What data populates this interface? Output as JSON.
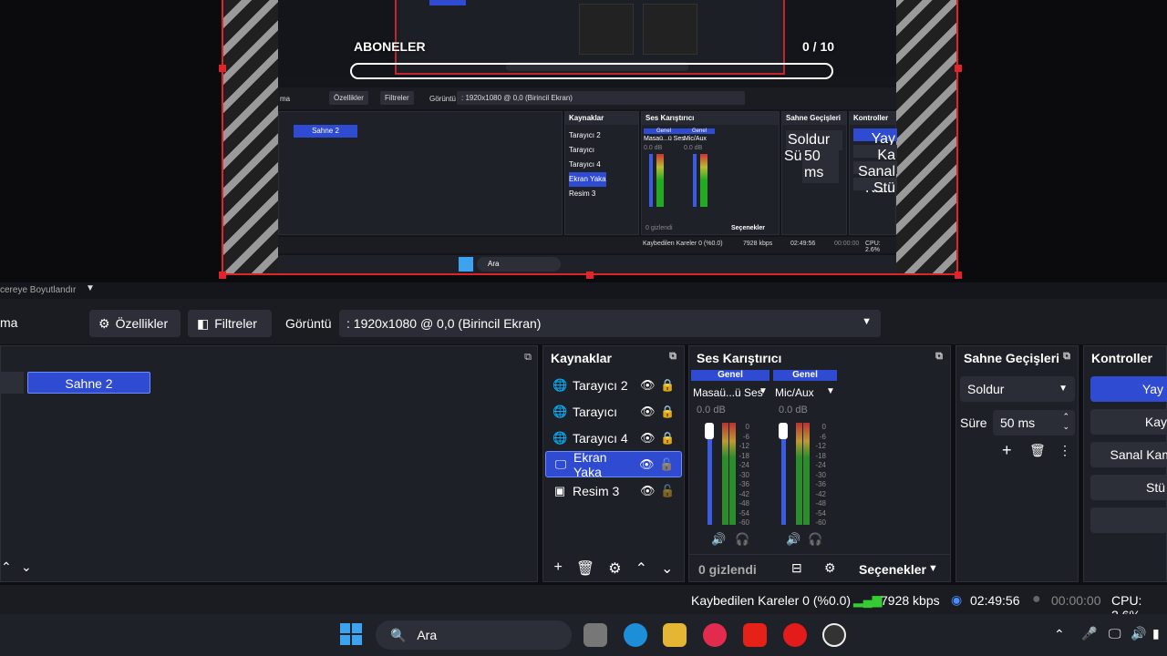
{
  "overlay": {
    "subscribers_label": "ABONELER",
    "subscribers_count": "0 / 10"
  },
  "mini": {
    "toolbar_left": "ma",
    "props": "Özellikler",
    "filters": "Filtreler",
    "display_label": "Görüntü",
    "display_value": ": 1920x1080 @ 0,0 (Birincil Ekran)",
    "scene": "Sahne 2",
    "sources_title": "Kaynaklar",
    "sources": [
      "Tarayıcı 2",
      "Tarayıcı",
      "Tarayıcı 4",
      "Ekran Yaka",
      "Resim 3"
    ],
    "mixer_title": "Ses Karıştırıcı",
    "ch1_label": "Genel",
    "ch2_label": "Genel",
    "ch1": "Masaü...ü Ses",
    "ch2": "Mic/Aux",
    "db": "0.0 dB",
    "hidden": "0 gizlendi",
    "options": "Seçenekler",
    "trans_title": "Sahne Geçişleri",
    "trans": "Soldur",
    "dur_label": "Süre",
    "dur": "50 ms",
    "controls_title": "Kontroller",
    "ctrl": [
      "Yay",
      "Ka",
      "Sanal Kam",
      "Stü"
    ],
    "status": "Kaybedilen Kareler 0 (%0.0)",
    "kbps": "7928 kbps",
    "time": "02:49:56",
    "rec": "00:00:00",
    "cpu": "CPU: 2.6%",
    "search": "Ara"
  },
  "strip": {
    "text": "cereye Boyutlandır"
  },
  "toolbar": {
    "left_text": "ma",
    "properties": "Özellikler",
    "filters": "Filtreler",
    "display_label": "Görüntü",
    "display_value": ": 1920x1080 @ 0,0 (Birincil Ekran)"
  },
  "scenes": {
    "scene2": "Sahne 2"
  },
  "sources": {
    "title": "Kaynaklar",
    "items": [
      "Tarayıcı 2",
      "Tarayıcı",
      "Tarayıcı 4",
      "Ekran Yaka",
      "Resim 3"
    ]
  },
  "mixer": {
    "title": "Ses Karıştırıcı",
    "ch1_header": "Genel",
    "ch2_header": "Genel",
    "ch1_name": "Masaü...ü Ses",
    "ch2_name": "Mic/Aux",
    "ch1_db": "0.0 dB",
    "ch2_db": "0.0 dB",
    "scale": [
      "0",
      "-6",
      "-12",
      "-18",
      "-24",
      "-30",
      "-36",
      "-42",
      "-48",
      "-54",
      "-60"
    ],
    "hidden": "0 gizlendi",
    "options": "Seçenekler"
  },
  "transitions": {
    "title": "Sahne Geçişleri",
    "value": "Soldur",
    "duration_label": "Süre",
    "duration": "50 ms"
  },
  "controls": {
    "title": "Kontroller",
    "buttons": [
      "Yay",
      "Kay",
      "Sanal Kam",
      "Stü"
    ]
  },
  "status": {
    "dropped": "Kaybedilen Kareler 0 (%0.0)",
    "kbps": "7928 kbps",
    "stream_time": "02:49:56",
    "rec_time": "00:00:00",
    "cpu": "CPU: 2.6%"
  },
  "taskbar": {
    "search": "Ara"
  },
  "colors": {
    "accent": "#2e4bd1",
    "red": "#e0242c",
    "panel": "#1e2027"
  }
}
